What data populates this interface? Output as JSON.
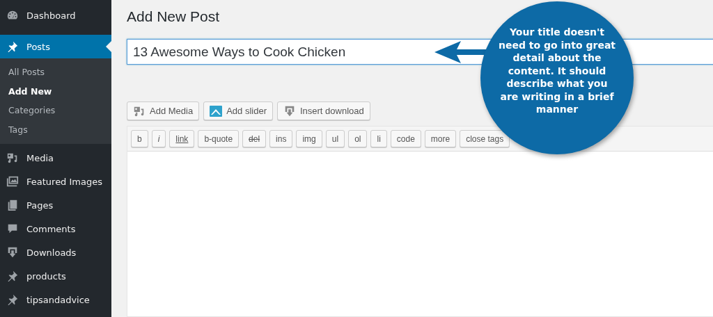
{
  "sidebar": {
    "items": [
      {
        "label": "Dashboard",
        "selected": false
      },
      {
        "label": "Posts",
        "selected": true,
        "children": [
          {
            "label": "All Posts",
            "selected": false
          },
          {
            "label": "Add New",
            "selected": true
          },
          {
            "label": "Categories",
            "selected": false
          },
          {
            "label": "Tags",
            "selected": false
          }
        ]
      },
      {
        "label": "Media",
        "selected": false
      },
      {
        "label": "Featured Images",
        "selected": false
      },
      {
        "label": "Pages",
        "selected": false
      },
      {
        "label": "Comments",
        "selected": false
      },
      {
        "label": "Downloads",
        "selected": false
      },
      {
        "label": "products",
        "selected": false
      },
      {
        "label": "tipsandadvice",
        "selected": false
      }
    ]
  },
  "page_title": "Add New Post",
  "title_field": {
    "value": "13 Awesome Ways to Cook Chicken"
  },
  "media_buttons": [
    {
      "label": "Add Media"
    },
    {
      "label": "Add slider"
    },
    {
      "label": "Insert download"
    }
  ],
  "quicktags": [
    {
      "label": "b",
      "kind": "plain"
    },
    {
      "label": "i",
      "kind": "italic"
    },
    {
      "label": "link",
      "kind": "link"
    },
    {
      "label": "b-quote",
      "kind": "plain"
    },
    {
      "label": "del",
      "kind": "strike"
    },
    {
      "label": "ins",
      "kind": "plain"
    },
    {
      "label": "img",
      "kind": "plain"
    },
    {
      "label": "ul",
      "kind": "plain"
    },
    {
      "label": "ol",
      "kind": "plain"
    },
    {
      "label": "li",
      "kind": "plain"
    },
    {
      "label": "code",
      "kind": "plain"
    },
    {
      "label": "more",
      "kind": "plain"
    },
    {
      "label": "close tags",
      "kind": "plain"
    }
  ],
  "callout": {
    "text": "Your title doesn't need to go into great detail about the content. It should describe what you are writing in a brief manner"
  }
}
